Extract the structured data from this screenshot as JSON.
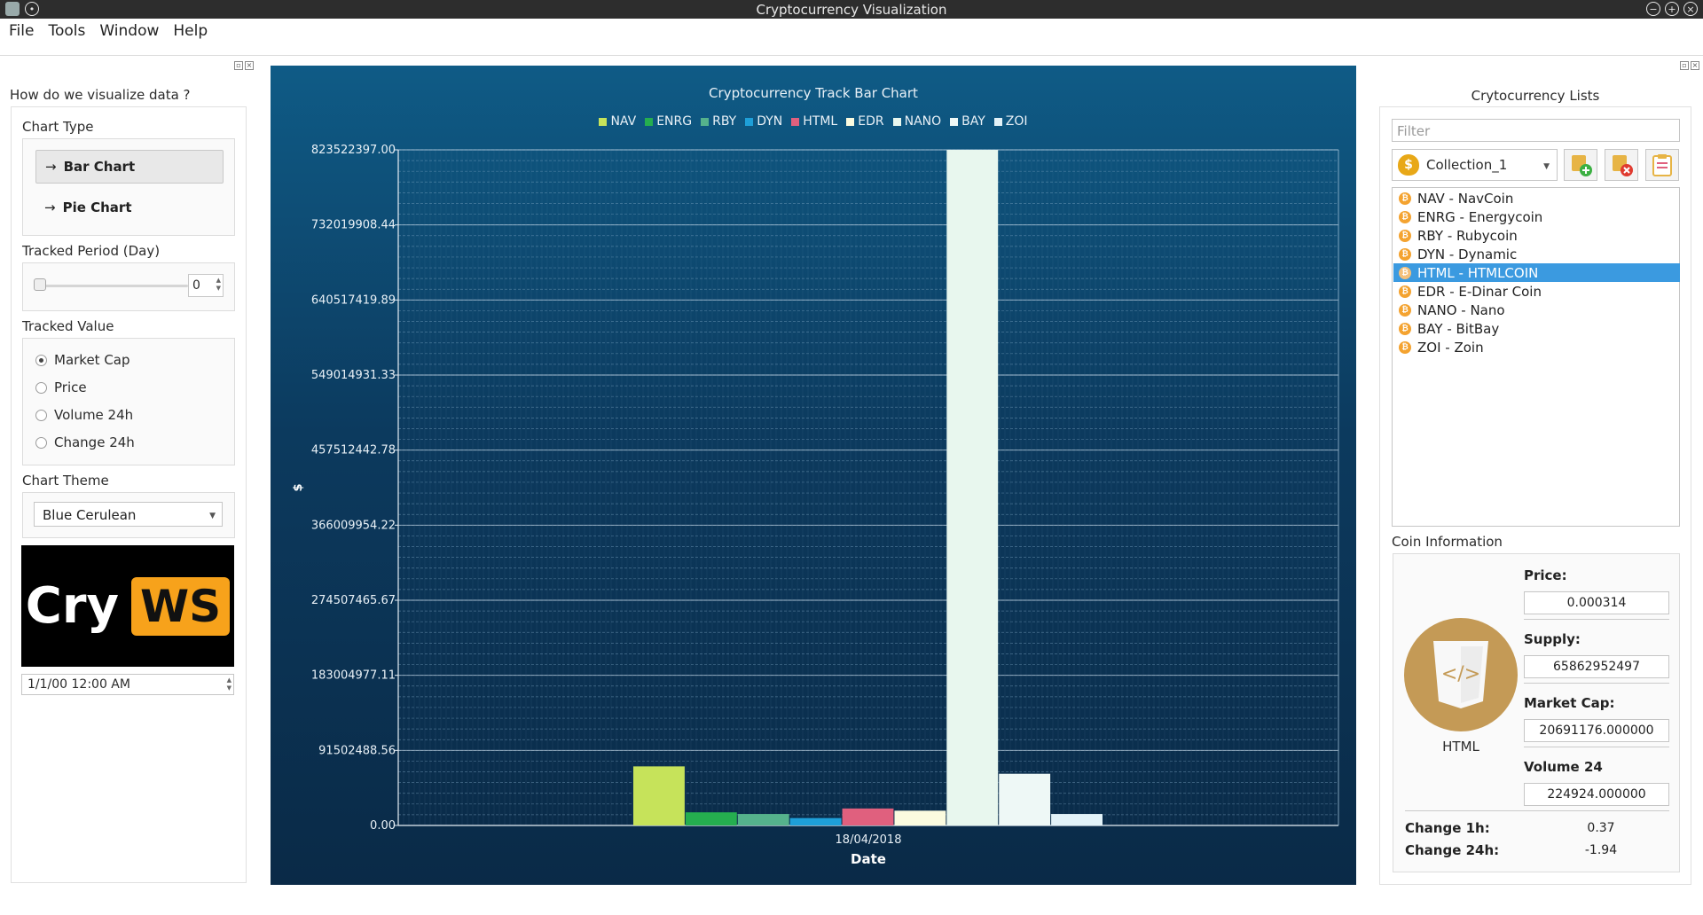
{
  "window": {
    "title": "Cryptocurrency Visualization"
  },
  "menu": [
    "File",
    "Tools",
    "Window",
    "Help"
  ],
  "left": {
    "heading": "How do we visualize data ?",
    "chart_type_label": "Chart Type",
    "chart_types": [
      "Bar Chart",
      "Pie Chart"
    ],
    "period_label": "Tracked Period (Day)",
    "period_value": "0",
    "tracked_value_label": "Tracked Value",
    "tracked_values": [
      "Market Cap",
      "Price",
      "Volume 24h",
      "Change 24h"
    ],
    "tracked_selected": "Market Cap",
    "theme_label": "Chart Theme",
    "theme_value": "Blue Cerulean",
    "logo_text_a": "Cry",
    "logo_text_b": "WS",
    "datetime": "1/1/00 12:00 AM"
  },
  "chart_data": {
    "type": "bar",
    "title": "Cryptocurrency Track Bar Chart",
    "xlabel": "Date",
    "ylabel": "$",
    "categories": [
      "18/04/2018"
    ],
    "ylim": [
      0,
      823522397.0
    ],
    "ytick_labels": [
      "0.00",
      "91502488.56",
      "183004977.11",
      "274507465.67",
      "366009954.22",
      "457512442.78",
      "549014931.33",
      "640517419.89",
      "732019908.44",
      "823522397.00"
    ],
    "series": [
      {
        "name": "NAV",
        "color": "#c6e35a",
        "values": [
          72000000
        ]
      },
      {
        "name": "ENRG",
        "color": "#25ae4f",
        "values": [
          16000000
        ]
      },
      {
        "name": "RBY",
        "color": "#55b28c",
        "values": [
          14000000
        ]
      },
      {
        "name": "DYN",
        "color": "#1e9fd8",
        "values": [
          9000000
        ]
      },
      {
        "name": "HTML",
        "color": "#e0607e",
        "values": [
          20691176
        ]
      },
      {
        "name": "EDR",
        "color": "#fbfbdf",
        "values": [
          18000000
        ]
      },
      {
        "name": "NANO",
        "color": "#e8f7ee",
        "values": [
          823522397
        ]
      },
      {
        "name": "BAY",
        "color": "#eef8f6",
        "values": [
          63000000
        ]
      },
      {
        "name": "ZOI",
        "color": "#e2f2f8",
        "values": [
          14000000
        ]
      }
    ]
  },
  "right": {
    "heading": "Crytocurrency Lists",
    "filter_placeholder": "Filter",
    "collection": "Collection_1",
    "coins": [
      "NAV - NavCoin",
      "ENRG - Energycoin",
      "RBY - Rubycoin",
      "DYN - Dynamic",
      "HTML - HTMLCOIN",
      "EDR - E-Dinar Coin",
      "NANO - Nano",
      "BAY - BitBay",
      "ZOI - Zoin"
    ],
    "selected_coin": "HTML - HTMLCOIN",
    "info_label": "Coin Information",
    "coin_name": "HTML",
    "price_label": "Price:",
    "price": "0.000314",
    "supply_label": "Supply:",
    "supply": "65862952497",
    "mcap_label": "Market Cap:",
    "mcap": "20691176.000000",
    "volume_label": "Volume 24",
    "volume": "224924.000000",
    "change1h_label": "Change 1h:",
    "change1h": "0.37",
    "change24h_label": "Change 24h:",
    "change24h": "-1.94"
  }
}
